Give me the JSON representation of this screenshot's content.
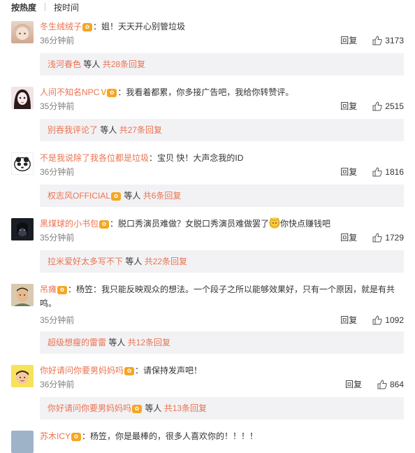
{
  "sort": {
    "hot": "按热度",
    "time": "按时间"
  },
  "comments": [
    {
      "user": "冬生绒绒子",
      "sep": "：",
      "text": "姐！天天开心别管垃圾",
      "time": "36分钟前",
      "reply": "回复",
      "likes": "3173",
      "sub": {
        "name": "浅河春色",
        "more_prefix": " 等人 ",
        "more": "共28条回复",
        "badge": false
      }
    },
    {
      "user": "人间不知名NPC",
      "sep": "：",
      "text": "我看着都累，你多接广告吧，我给你转赞评。",
      "time": "35分钟前",
      "reply": "回复",
      "likes": "2515",
      "sub": {
        "name": "别吞我评论了",
        "more_prefix": " 等人 ",
        "more": "共27条回复",
        "badge": false
      }
    },
    {
      "user": "不是我说除了我各位都是垃圾",
      "sep": "：",
      "text": "宝贝 快！大声念我的ID",
      "time": "36分钟前",
      "reply": "回复",
      "likes": "1816",
      "sub": {
        "name": "权志风OFFICIAL",
        "more_prefix": " 等人 ",
        "more": "共6条回复",
        "badge": true
      }
    },
    {
      "user": "黑煤球的小书包",
      "sep": "：",
      "text": "脱口秀演员难做？女脱口秀演员难做罢了",
      "text2": "你快点赚钱吧",
      "time": "35分钟前",
      "reply": "回复",
      "likes": "1729",
      "sub": {
        "name": "拉米爱好太多写不下",
        "more_prefix": " 等人 ",
        "more": "共22条回复",
        "badge": false
      }
    },
    {
      "user": "吊瘫",
      "sep": "：",
      "text": "杨笠：我只能反映观众的想法。一个段子之所以能够效果好，只有一个原因，就是有共鸣。",
      "time": "35分钟前",
      "reply": "回复",
      "likes": "1092",
      "sub": {
        "name": "超级想瘦的雷雷",
        "more_prefix": " 等人 ",
        "more": "共12条回复",
        "badge": false
      }
    },
    {
      "user": "你好请问你要男妈妈吗",
      "sep": "：",
      "text": "请保持发声吧！",
      "time": "36分钟前",
      "reply": "回复",
      "likes": "864",
      "sub": {
        "name": "你好请问你要男妈妈吗",
        "more_prefix": " 等人 ",
        "more": "共13条回复",
        "badge": true
      }
    },
    {
      "user": "苏木ICY",
      "sep": "：",
      "text": "杨笠，你是最棒的，很多人喜欢你的！！！！",
      "time": "",
      "reply": "",
      "likes": ""
    }
  ]
}
